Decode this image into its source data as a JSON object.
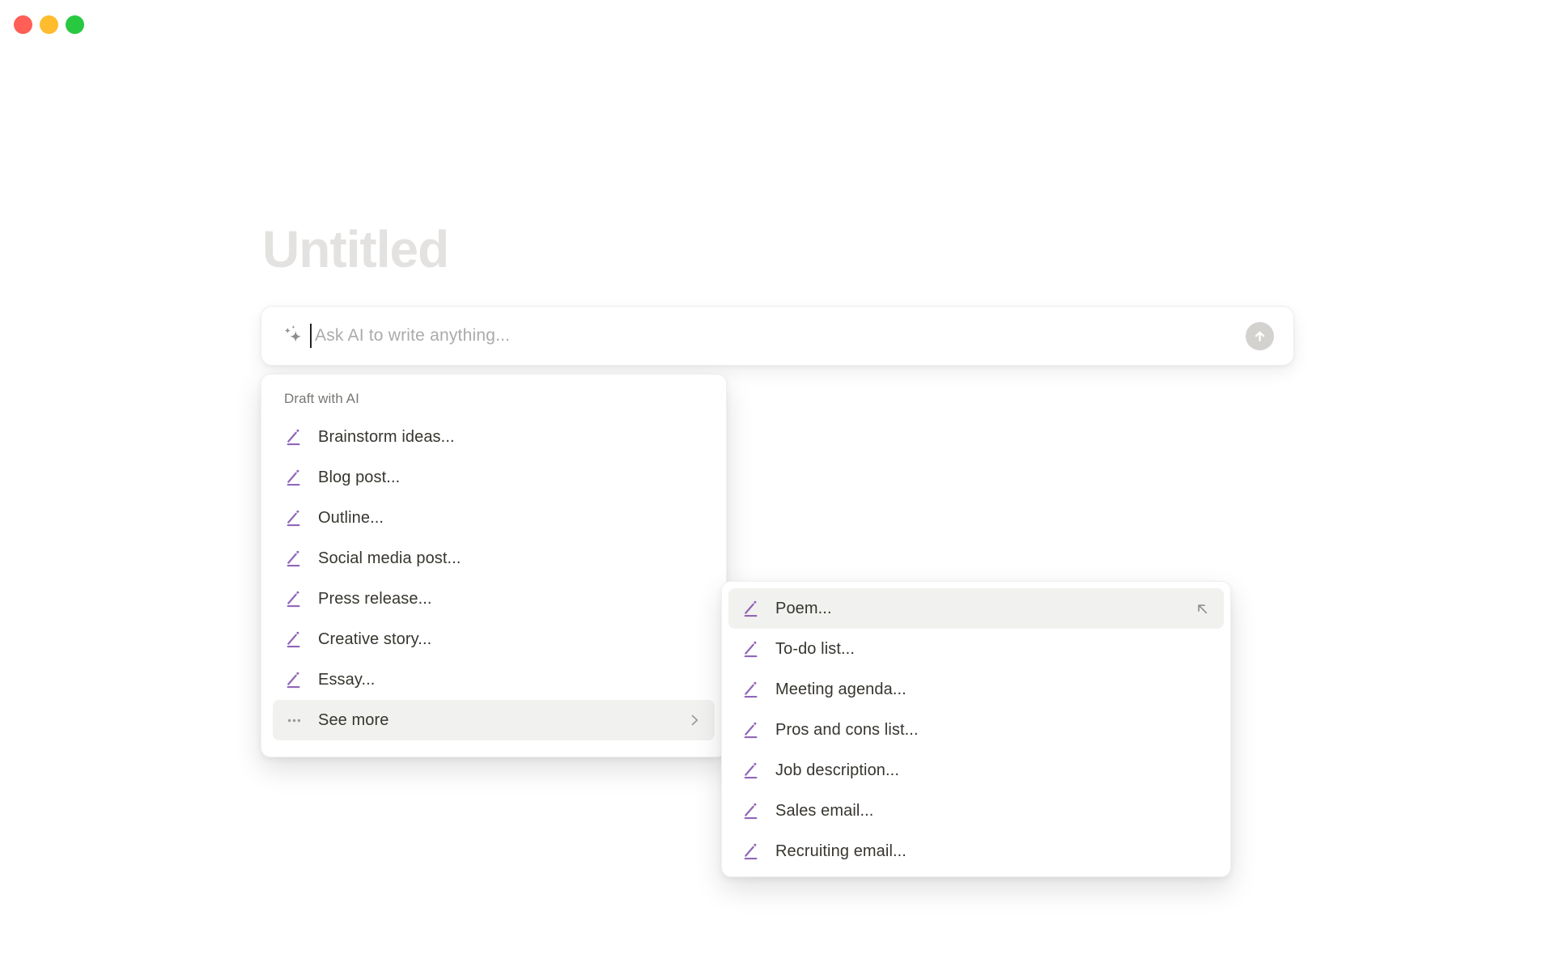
{
  "window": {
    "controls": [
      {
        "name": "close",
        "color": "#ff5f57"
      },
      {
        "name": "minimize",
        "color": "#febc2e"
      },
      {
        "name": "zoom",
        "color": "#28c840"
      }
    ]
  },
  "document": {
    "title_placeholder": "Untitled"
  },
  "ai_input": {
    "placeholder": "Ask AI to write anything...",
    "leading_icon": "sparkle-icon",
    "send_icon": "arrow-up-icon"
  },
  "draft_menu": {
    "header": "Draft with AI",
    "items": [
      {
        "label": "Brainstorm ideas...",
        "icon": "pencil-icon"
      },
      {
        "label": "Blog post...",
        "icon": "pencil-icon"
      },
      {
        "label": "Outline...",
        "icon": "pencil-icon"
      },
      {
        "label": "Social media post...",
        "icon": "pencil-icon"
      },
      {
        "label": "Press release...",
        "icon": "pencil-icon"
      },
      {
        "label": "Creative story...",
        "icon": "pencil-icon"
      },
      {
        "label": "Essay...",
        "icon": "pencil-icon"
      },
      {
        "label": "See more",
        "icon": "ellipsis-icon",
        "trailing_icon": "chevron-right-icon",
        "highlighted": true
      }
    ]
  },
  "see_more_submenu": {
    "items": [
      {
        "label": "Poem...",
        "icon": "pencil-icon",
        "trailing_icon": "arrow-up-left-icon",
        "highlighted": true
      },
      {
        "label": "To-do list...",
        "icon": "pencil-icon"
      },
      {
        "label": "Meeting agenda...",
        "icon": "pencil-icon"
      },
      {
        "label": "Pros and cons list...",
        "icon": "pencil-icon"
      },
      {
        "label": "Job description...",
        "icon": "pencil-icon"
      },
      {
        "label": "Sales email...",
        "icon": "pencil-icon"
      },
      {
        "label": "Recruiting email...",
        "icon": "pencil-icon"
      }
    ]
  },
  "colors": {
    "accent_purple": "#9166b8",
    "highlight_row": "#f1f1ef",
    "item_text": "#37352f",
    "muted_text": "#787774",
    "icon_gray": "#9b9a97",
    "placeholder_text": "#acaba9",
    "title_placeholder_text": "#e3e2e0",
    "send_button_bg": "#d3d2cf"
  }
}
